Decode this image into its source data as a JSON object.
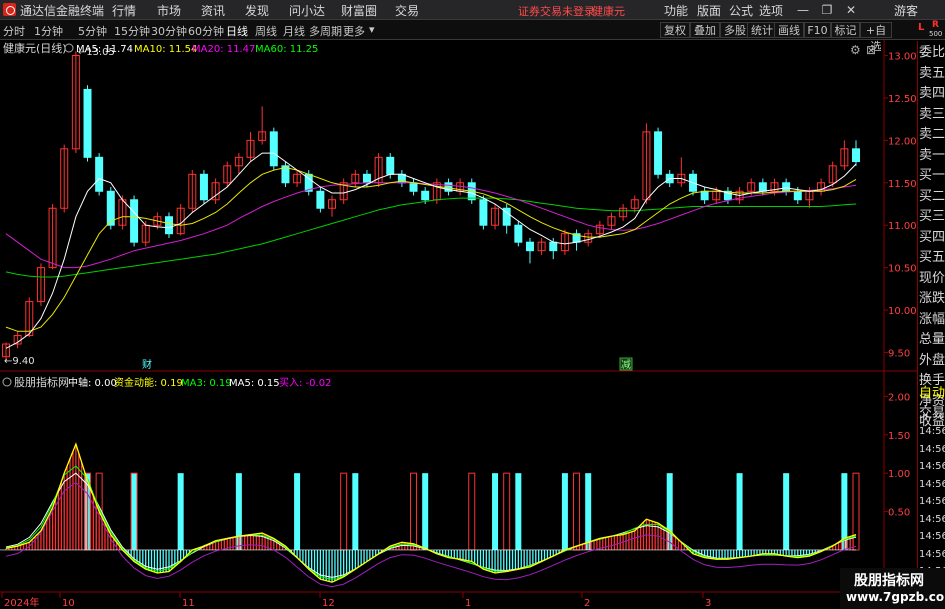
{
  "titlebar": {
    "app_name": "通达信金融终端",
    "menu": [
      "行情",
      "市场",
      "资讯",
      "发现",
      "问小达",
      "财富圈",
      "交易"
    ],
    "notice": "证券交易未登录",
    "stock_name": "健康元",
    "right_menu": [
      "功能",
      "版面",
      "公式",
      "选项"
    ],
    "user": "游客"
  },
  "toolbar": {
    "periods": [
      "分时",
      "1分钟",
      "5分钟",
      "15分钟",
      "30分钟",
      "60分钟",
      "日线",
      "周线",
      "月线",
      "多周期",
      "更多"
    ],
    "active_period": "日线",
    "buttons": [
      "复权",
      "叠加",
      "多股",
      "统计",
      "画线",
      "F10",
      "标记",
      "+自选"
    ],
    "l_badge": "L",
    "r_badge": "R",
    "r_sub": "500"
  },
  "main_chart": {
    "title": "健康元(日线)",
    "ma": [
      {
        "label": "MA5: 11.74",
        "color": "#ffffff"
      },
      {
        "label": "MA10: 11.54",
        "color": "#ffff00"
      },
      {
        "label": "MA20: 11.47",
        "color": "#ff00ff"
      },
      {
        "label": "MA60: 11.25",
        "color": "#00ff00"
      }
    ],
    "high_label": "13.05",
    "low_label": "9.40",
    "marker_cai": "财",
    "marker_jian": "减",
    "y_ticks": [
      "13.00",
      "12.50",
      "12.00",
      "11.50",
      "11.00",
      "10.50",
      "10.00",
      "9.50"
    ]
  },
  "indicator": {
    "title": "股朋指标网",
    "items": [
      {
        "label": "中轴: 0.00",
        "color": "#ffffff"
      },
      {
        "label": "资金动能: 0.19",
        "color": "#ffff00"
      },
      {
        "label": "MA3: 0.19",
        "color": "#00ff00"
      },
      {
        "label": "MA5: 0.15",
        "color": "#ffffff"
      },
      {
        "label": "买入: -0.02",
        "color": "#ff00ff"
      }
    ],
    "y_ticks": [
      "2.00",
      "1.50",
      "1.00",
      "0.50"
    ]
  },
  "x_axis": [
    "2024年",
    "10",
    "11",
    "12",
    "1",
    "2",
    "3"
  ],
  "right_panel": {
    "labels": [
      "委比",
      "卖五",
      "卖四",
      "卖三",
      "卖二",
      "卖一",
      "买一",
      "买二",
      "买三",
      "买四",
      "买五",
      "现价",
      "涨跌",
      "涨幅",
      "总量",
      "外盘",
      "换手",
      "净资",
      "收益"
    ],
    "auto_trade": [
      "自动",
      "交易"
    ],
    "times": [
      "14:56",
      "14:56",
      "14:56",
      "14:56",
      "14:56",
      "14:56",
      "14:56",
      "14:56",
      "14:56",
      "14:56"
    ]
  },
  "watermark": {
    "line1": "股朋指标网",
    "line2": "www.7gpzb.com"
  },
  "chart_data": {
    "type": "candlestick",
    "price_range": [
      9.4,
      13.1
    ],
    "candles": [
      [
        9.45,
        9.6,
        9.62,
        9.4
      ],
      [
        9.6,
        9.7,
        9.75,
        9.55
      ],
      [
        9.7,
        10.1,
        10.15,
        9.68
      ],
      [
        10.1,
        10.5,
        10.55,
        10.05
      ],
      [
        10.5,
        11.2,
        11.25,
        10.48
      ],
      [
        11.2,
        11.9,
        11.95,
        11.15
      ],
      [
        11.9,
        13.0,
        13.05,
        11.85
      ],
      [
        12.6,
        11.8,
        12.65,
        11.75
      ],
      [
        11.8,
        11.4,
        11.85,
        11.35
      ],
      [
        11.4,
        11.0,
        11.45,
        10.95
      ],
      [
        11.0,
        11.3,
        11.35,
        10.95
      ],
      [
        11.3,
        10.8,
        11.35,
        10.75
      ],
      [
        10.8,
        11.0,
        11.05,
        10.75
      ],
      [
        11.0,
        11.1,
        11.15,
        10.95
      ],
      [
        11.1,
        10.9,
        11.15,
        10.85
      ],
      [
        10.9,
        11.2,
        11.25,
        10.88
      ],
      [
        11.2,
        11.6,
        11.65,
        11.15
      ],
      [
        11.6,
        11.3,
        11.65,
        11.25
      ],
      [
        11.3,
        11.5,
        11.55,
        11.25
      ],
      [
        11.5,
        11.7,
        11.75,
        11.45
      ],
      [
        11.7,
        11.8,
        11.85,
        11.6
      ],
      [
        11.8,
        12.0,
        12.1,
        11.75
      ],
      [
        12.0,
        12.1,
        12.4,
        11.95
      ],
      [
        12.1,
        11.7,
        12.15,
        11.65
      ],
      [
        11.7,
        11.5,
        11.75,
        11.45
      ],
      [
        11.5,
        11.6,
        11.65,
        11.45
      ],
      [
        11.6,
        11.4,
        11.65,
        11.35
      ],
      [
        11.4,
        11.2,
        11.45,
        11.15
      ],
      [
        11.2,
        11.3,
        11.35,
        11.1
      ],
      [
        11.3,
        11.5,
        11.55,
        11.25
      ],
      [
        11.5,
        11.6,
        11.65,
        11.45
      ],
      [
        11.6,
        11.5,
        11.65,
        11.45
      ],
      [
        11.5,
        11.8,
        11.85,
        11.45
      ],
      [
        11.8,
        11.6,
        11.85,
        11.55
      ],
      [
        11.6,
        11.5,
        11.65,
        11.45
      ],
      [
        11.5,
        11.4,
        11.55,
        11.35
      ],
      [
        11.4,
        11.3,
        11.45,
        11.25
      ],
      [
        11.3,
        11.5,
        11.55,
        11.25
      ],
      [
        11.5,
        11.4,
        11.55,
        11.35
      ],
      [
        11.4,
        11.5,
        11.55,
        11.35
      ],
      [
        11.5,
        11.3,
        11.55,
        11.25
      ],
      [
        11.3,
        11.0,
        11.35,
        10.95
      ],
      [
        11.0,
        11.2,
        11.25,
        10.95
      ],
      [
        11.2,
        11.0,
        11.25,
        10.9
      ],
      [
        11.0,
        10.8,
        11.05,
        10.75
      ],
      [
        10.8,
        10.7,
        10.85,
        10.55
      ],
      [
        10.7,
        10.8,
        10.85,
        10.65
      ],
      [
        10.8,
        10.7,
        10.85,
        10.6
      ],
      [
        10.7,
        10.9,
        10.95,
        10.65
      ],
      [
        10.9,
        10.8,
        10.95,
        10.7
      ],
      [
        10.8,
        10.9,
        10.95,
        10.75
      ],
      [
        10.9,
        11.0,
        11.05,
        10.85
      ],
      [
        11.0,
        11.1,
        11.15,
        10.95
      ],
      [
        11.1,
        11.2,
        11.25,
        11.05
      ],
      [
        11.2,
        11.3,
        11.35,
        11.15
      ],
      [
        11.3,
        12.1,
        12.2,
        11.25
      ],
      [
        12.1,
        11.6,
        12.15,
        11.55
      ],
      [
        11.6,
        11.5,
        11.65,
        11.45
      ],
      [
        11.5,
        11.6,
        11.8,
        11.45
      ],
      [
        11.6,
        11.4,
        11.65,
        11.35
      ],
      [
        11.4,
        11.3,
        11.45,
        11.25
      ],
      [
        11.3,
        11.4,
        11.45,
        11.25
      ],
      [
        11.4,
        11.3,
        11.45,
        11.25
      ],
      [
        11.3,
        11.4,
        11.45,
        11.25
      ],
      [
        11.4,
        11.5,
        11.55,
        11.35
      ],
      [
        11.5,
        11.4,
        11.55,
        11.35
      ],
      [
        11.4,
        11.5,
        11.55,
        11.35
      ],
      [
        11.5,
        11.4,
        11.55,
        11.35
      ],
      [
        11.4,
        11.3,
        11.45,
        11.25
      ],
      [
        11.3,
        11.4,
        11.45,
        11.2
      ],
      [
        11.4,
        11.5,
        11.55,
        11.35
      ],
      [
        11.5,
        11.7,
        11.75,
        11.45
      ],
      [
        11.7,
        11.9,
        12.0,
        11.65
      ],
      [
        11.9,
        11.75,
        12.0,
        11.7
      ]
    ],
    "ma5": [
      9.55,
      9.62,
      9.72,
      9.9,
      10.2,
      10.6,
      11.1,
      11.4,
      11.55,
      11.5,
      11.3,
      11.15,
      11.0,
      10.98,
      10.97,
      11.02,
      11.15,
      11.25,
      11.35,
      11.45,
      11.6,
      11.75,
      11.85,
      11.85,
      11.75,
      11.65,
      11.55,
      11.45,
      11.38,
      11.38,
      11.42,
      11.48,
      11.55,
      11.6,
      11.6,
      11.55,
      11.5,
      11.45,
      11.42,
      11.4,
      11.38,
      11.32,
      11.25,
      11.15,
      11.05,
      10.95,
      10.88,
      10.8,
      10.78,
      10.8,
      10.83,
      10.87,
      10.92,
      10.98,
      11.08,
      11.3,
      11.45,
      11.55,
      11.55,
      11.5,
      11.45,
      11.42,
      11.38,
      11.35,
      11.38,
      11.4,
      11.42,
      11.44,
      11.42,
      11.4,
      11.42,
      11.48,
      11.58,
      11.72
    ],
    "ma10": [
      9.8,
      9.75,
      9.75,
      9.8,
      9.95,
      10.15,
      10.4,
      10.65,
      10.9,
      11.05,
      11.1,
      11.1,
      11.08,
      11.05,
      11.02,
      11.0,
      11.02,
      11.08,
      11.15,
      11.25,
      11.38,
      11.5,
      11.6,
      11.65,
      11.68,
      11.65,
      11.6,
      11.55,
      11.5,
      11.47,
      11.45,
      11.45,
      11.47,
      11.5,
      11.52,
      11.5,
      11.48,
      11.46,
      11.44,
      11.42,
      11.4,
      11.37,
      11.32,
      11.26,
      11.18,
      11.1,
      11.03,
      10.97,
      10.92,
      10.88,
      10.86,
      10.86,
      10.88,
      10.9,
      10.95,
      11.05,
      11.15,
      11.25,
      11.32,
      11.38,
      11.4,
      11.4,
      11.39,
      11.38,
      11.38,
      11.38,
      11.39,
      11.4,
      11.4,
      11.4,
      11.4,
      11.42,
      11.46,
      11.54
    ],
    "ma20": [
      10.9,
      10.8,
      10.7,
      10.6,
      10.55,
      10.5,
      10.5,
      10.52,
      10.56,
      10.6,
      10.65,
      10.7,
      10.73,
      10.76,
      10.79,
      10.82,
      10.86,
      10.9,
      10.95,
      11.0,
      11.08,
      11.15,
      11.22,
      11.28,
      11.33,
      11.38,
      11.42,
      11.45,
      11.47,
      11.48,
      11.49,
      11.5,
      11.5,
      11.5,
      11.5,
      11.5,
      11.49,
      11.48,
      11.47,
      11.46,
      11.44,
      11.41,
      11.38,
      11.34,
      11.3,
      11.25,
      11.2,
      11.15,
      11.1,
      11.05,
      11.0,
      10.97,
      10.95,
      10.94,
      10.95,
      10.98,
      11.02,
      11.07,
      11.12,
      11.17,
      11.22,
      11.26,
      11.29,
      11.32,
      11.34,
      11.36,
      11.38,
      11.39,
      11.4,
      11.41,
      11.42,
      11.43,
      11.45,
      11.47
    ],
    "ma60": [
      10.45,
      10.42,
      10.4,
      10.39,
      10.39,
      10.4,
      10.42,
      10.44,
      10.46,
      10.48,
      10.5,
      10.52,
      10.54,
      10.56,
      10.58,
      10.6,
      10.62,
      10.64,
      10.66,
      10.69,
      10.72,
      10.75,
      10.78,
      10.82,
      10.86,
      10.9,
      10.94,
      10.98,
      11.02,
      11.06,
      11.1,
      11.14,
      11.18,
      11.21,
      11.24,
      11.26,
      11.28,
      11.3,
      11.31,
      11.32,
      11.32,
      11.32,
      11.32,
      11.31,
      11.3,
      11.28,
      11.26,
      11.24,
      11.22,
      11.2,
      11.19,
      11.18,
      11.17,
      11.17,
      11.17,
      11.18,
      11.19,
      11.2,
      11.21,
      11.22,
      11.22,
      11.22,
      11.22,
      11.22,
      11.22,
      11.22,
      11.22,
      11.22,
      11.22,
      11.22,
      11.22,
      11.23,
      11.24,
      11.25
    ],
    "osc": [
      0.02,
      0.05,
      0.1,
      0.25,
      0.55,
      1.0,
      1.38,
      0.9,
      0.5,
      0.2,
      0.0,
      -0.15,
      -0.25,
      -0.3,
      -0.28,
      -0.15,
      0.0,
      0.05,
      0.12,
      0.15,
      0.18,
      0.2,
      0.22,
      0.15,
      0.05,
      -0.1,
      -0.25,
      -0.38,
      -0.42,
      -0.35,
      -0.25,
      -0.15,
      -0.05,
      0.05,
      0.1,
      0.08,
      0.02,
      -0.05,
      -0.1,
      -0.12,
      -0.15,
      -0.25,
      -0.3,
      -0.28,
      -0.25,
      -0.22,
      -0.15,
      -0.08,
      0.0,
      0.05,
      0.1,
      0.15,
      0.18,
      0.2,
      0.25,
      0.4,
      0.35,
      0.25,
      0.1,
      -0.05,
      -0.1,
      -0.12,
      -0.12,
      -0.1,
      -0.08,
      -0.05,
      -0.05,
      -0.08,
      -0.1,
      -0.08,
      -0.02,
      0.05,
      0.15,
      0.2
    ],
    "signal_bars": [
      11,
      17,
      23,
      31,
      39,
      48,
      57,
      66,
      70,
      75,
      78,
      90,
      99,
      105,
      113
    ],
    "red_bars": [
      7,
      8,
      11,
      29,
      35,
      40,
      43,
      49,
      73
    ]
  }
}
